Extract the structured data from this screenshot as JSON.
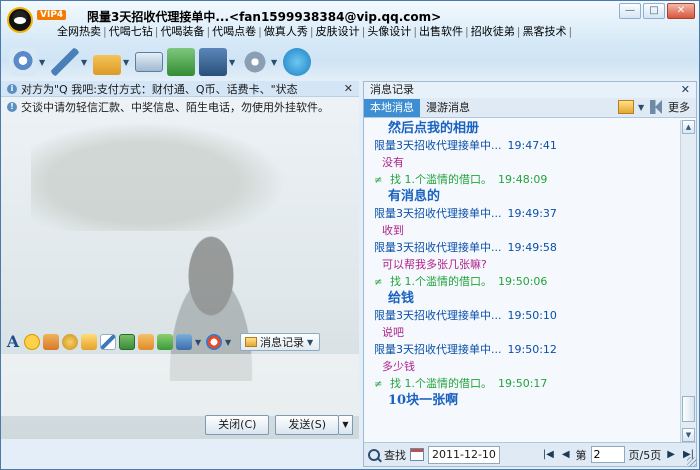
{
  "window": {
    "vip_badge": "VIP4",
    "contact_name": "限量3天招收代理接单中...<fan1599938384@vip.qq.com>",
    "ad_links": [
      "全网热卖",
      "代喝七钻",
      "代喝装备",
      "代喝点卷",
      "做真人秀",
      "皮肤设计",
      "头像设计",
      "出售软件",
      "招收徒弟",
      "黑客技术"
    ],
    "controls": [
      "—",
      "□",
      "✕"
    ]
  },
  "notice": {
    "text": "对方为\"Q 我吧:支付方式：财付通、Q币、话费卡、\"状态",
    "close": "✕",
    "warning": "交谈中请勿轻信汇款、中奖信息、陌生电话，勿使用外挂软件。"
  },
  "format_bar": {
    "font_glyph": "A",
    "msg_record_label": "消息记录"
  },
  "buttons": {
    "close": "关闭(C)",
    "send": "发送(S)",
    "send_drop": "▼"
  },
  "history": {
    "title": "消息记录",
    "close": "✕",
    "tabs": [
      "本地消息",
      "漫游消息"
    ],
    "more": "更多",
    "sender": "限量3天招收代理接单中...",
    "system_sender": "找 1.个滥情的借口。",
    "messages": [
      {
        "type": "big",
        "text": "然后点我的相册"
      },
      {
        "type": "header",
        "time": "19:47:41"
      },
      {
        "type": "mag",
        "text": "没有"
      },
      {
        "type": "sys",
        "time": "19:48:09"
      },
      {
        "type": "big",
        "text": "有消息的"
      },
      {
        "type": "header",
        "time": "19:49:37"
      },
      {
        "type": "mag",
        "text": "收到"
      },
      {
        "type": "header",
        "time": "19:49:58"
      },
      {
        "type": "mag",
        "text": "可以帮我多张几张嘛?"
      },
      {
        "type": "sys",
        "time": "19:50:06"
      },
      {
        "type": "big",
        "text": "给钱"
      },
      {
        "type": "header",
        "time": "19:50:10"
      },
      {
        "type": "mag",
        "text": "说吧"
      },
      {
        "type": "header",
        "time": "19:50:12"
      },
      {
        "type": "mag",
        "text": "多少钱"
      },
      {
        "type": "sys",
        "time": "19:50:17"
      },
      {
        "type": "big",
        "text": "10块一张啊"
      }
    ],
    "footer": {
      "search": "查找",
      "date": "2011-12-10",
      "page_prefix": "第",
      "page_value": "2",
      "page_suffix": "页/5页",
      "nav": [
        "|◀",
        "◀",
        "▶",
        "▶|"
      ]
    }
  },
  "icons": {
    "toolbar": [
      "video-icon",
      "voice-icon",
      "transfer-file-icon",
      "sms-icon",
      "share-icon",
      "app-icon",
      "settings-icon",
      "computer-assist-icon"
    ]
  }
}
